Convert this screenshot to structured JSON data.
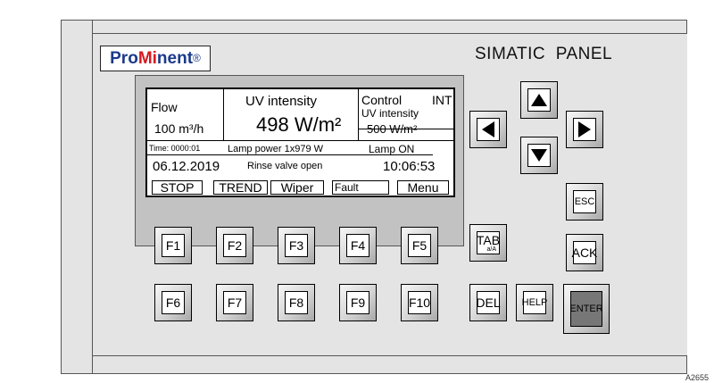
{
  "brand": {
    "part1": "Pro",
    "part2": "Mi",
    "part3": "nent",
    "reg": "®"
  },
  "panel_title": "SIMATIC  PANEL",
  "display": {
    "flow_label": "Flow",
    "flow_value": "100 m³/h",
    "uv_label": "UV intensity",
    "uv_value": "498 W/m²",
    "control_label": "Control",
    "control_mode": "INT",
    "control_sub": "UV intensity",
    "control_value": "500 W/m²",
    "time_label": "Time: 0000:01",
    "lamp_power": "Lamp power 1x979 W",
    "lamp_status": "Lamp ON",
    "date": "06.12.2019",
    "status_msg": "Rinse valve open",
    "time": "10:06:53",
    "softkeys": [
      "STOP",
      "TREND",
      "Wiper",
      "Fault",
      "Menu"
    ]
  },
  "keys": {
    "f1": "F1",
    "f2": "F2",
    "f3": "F3",
    "f4": "F4",
    "f5": "F5",
    "f6": "F6",
    "f7": "F7",
    "f8": "F8",
    "f9": "F9",
    "f10": "F10",
    "tab": "TAB",
    "tab_sub": "a/A",
    "esc": "ESC",
    "ack": "ACK",
    "del": "DEL",
    "help": "HELP",
    "enter": "ENTER"
  },
  "colors": {
    "brand_blue": "#1a3a8a",
    "brand_red": "#d71920",
    "enter_key": "#777777"
  },
  "figure_id": "A2655"
}
